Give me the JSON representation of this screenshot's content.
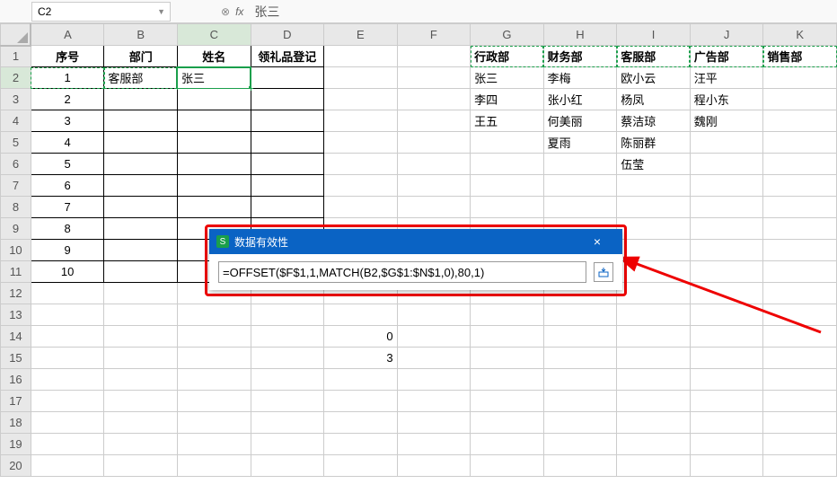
{
  "nameBox": "C2",
  "formulaBarValue": "张三",
  "columns": [
    "A",
    "B",
    "C",
    "D",
    "E",
    "F",
    "G",
    "H",
    "I",
    "J",
    "K"
  ],
  "rowCount": 20,
  "activeCell": {
    "row": 2,
    "col": "C"
  },
  "leftTable": {
    "headers": [
      "序号",
      "部门",
      "姓名",
      "领礼品登记"
    ],
    "rows": [
      {
        "n": "1",
        "dept": "客服部",
        "name": "张三"
      },
      {
        "n": "2",
        "dept": "",
        "name": ""
      },
      {
        "n": "3",
        "dept": "",
        "name": ""
      },
      {
        "n": "4",
        "dept": "",
        "name": ""
      },
      {
        "n": "5",
        "dept": "",
        "name": ""
      },
      {
        "n": "6",
        "dept": "",
        "name": ""
      },
      {
        "n": "7",
        "dept": "",
        "name": ""
      },
      {
        "n": "8",
        "dept": "",
        "name": ""
      },
      {
        "n": "9",
        "dept": "",
        "name": ""
      },
      {
        "n": "10",
        "dept": "",
        "name": ""
      }
    ]
  },
  "rightTable": {
    "headers": [
      "行政部",
      "财务部",
      "客服部",
      "广告部",
      "销售部"
    ],
    "data": [
      [
        "张三",
        "李梅",
        "欧小云",
        "汪平",
        ""
      ],
      [
        "李四",
        "张小红",
        "杨凤",
        "程小东",
        ""
      ],
      [
        "王五",
        "何美丽",
        "蔡洁琼",
        "魏刚",
        ""
      ],
      [
        "",
        "夏雨",
        "陈丽群",
        "",
        ""
      ],
      [
        "",
        "",
        "伍莹",
        "",
        ""
      ]
    ]
  },
  "extraCells": {
    "E14": "0",
    "E15": "3"
  },
  "dialog": {
    "title": "数据有效性",
    "formula": "=OFFSET($F$1,1,MATCH(B2,$G$1:$N$1,0),80,1)"
  },
  "icons": {
    "close": "×",
    "dropdown": "▼",
    "collapse": "⬓"
  }
}
